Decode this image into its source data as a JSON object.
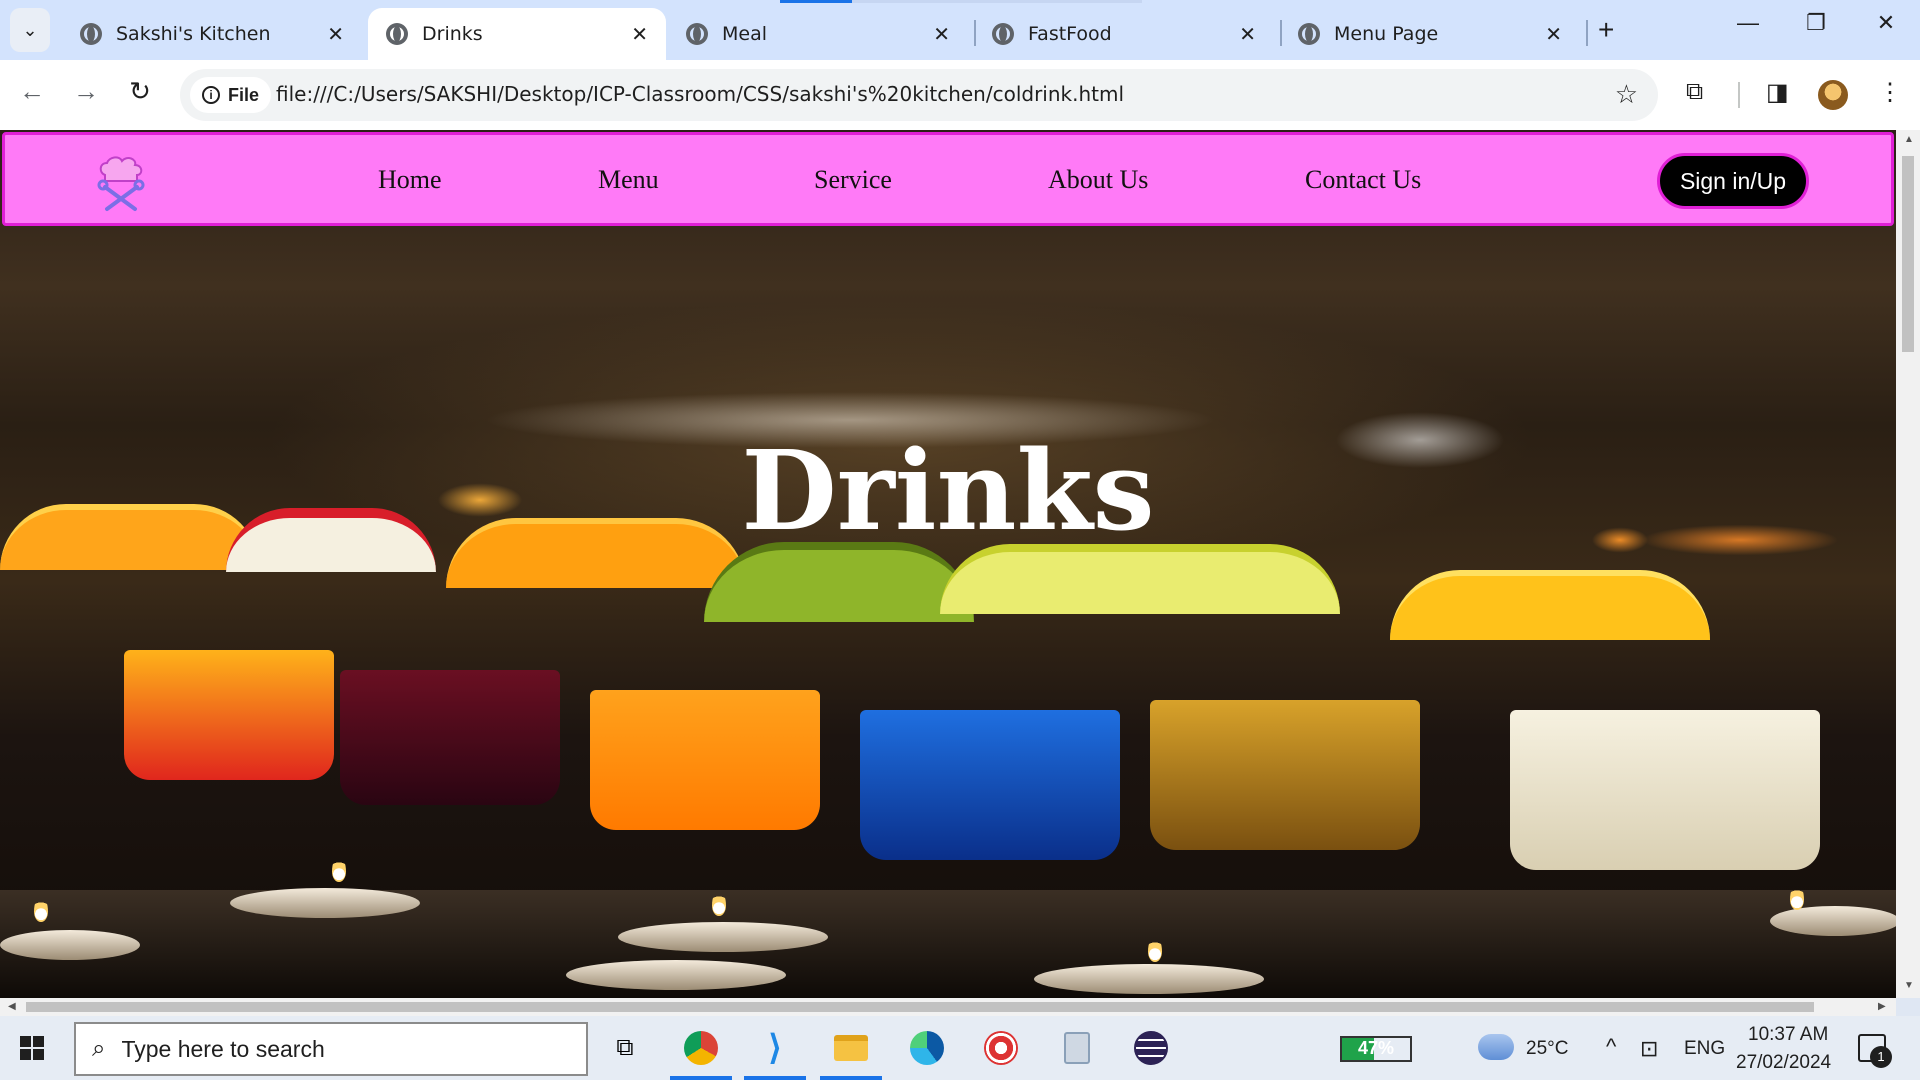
{
  "browser": {
    "tabs": [
      {
        "title": "Sakshi's Kitchen",
        "active": false
      },
      {
        "title": "Drinks",
        "active": true
      },
      {
        "title": "Meal",
        "active": false
      },
      {
        "title": "FastFood",
        "active": false
      },
      {
        "title": "Menu Page",
        "active": false
      }
    ],
    "site_chip": "File",
    "url": "file:///C:/Users/SAKSHI/Desktop/ICP-Classroom/CSS/sakshi's%20kitchen/coldrink.html",
    "icons": {
      "tab_search": "chevron-down-icon",
      "new_tab": "plus-icon",
      "back": "arrow-left-icon",
      "forward": "arrow-right-icon",
      "reload": "reload-icon",
      "bookmark": "star-icon",
      "extensions": "puzzle-icon",
      "side_panel": "side-panel-icon",
      "menu": "kebab-menu-icon"
    }
  },
  "site": {
    "nav": {
      "links": [
        "Home",
        "Menu",
        "Service",
        "About Us",
        "Contact Us"
      ],
      "cta": "Sign in/Up",
      "accent": "#ff7af7",
      "border": "#e01fd6"
    },
    "hero": {
      "title": "Drinks"
    }
  },
  "taskbar": {
    "search_placeholder": "Type here to search",
    "battery": "47%",
    "temperature": "25°C",
    "language": "ENG",
    "time": "10:37 AM",
    "date": "27/02/2024",
    "notifications": "1"
  }
}
